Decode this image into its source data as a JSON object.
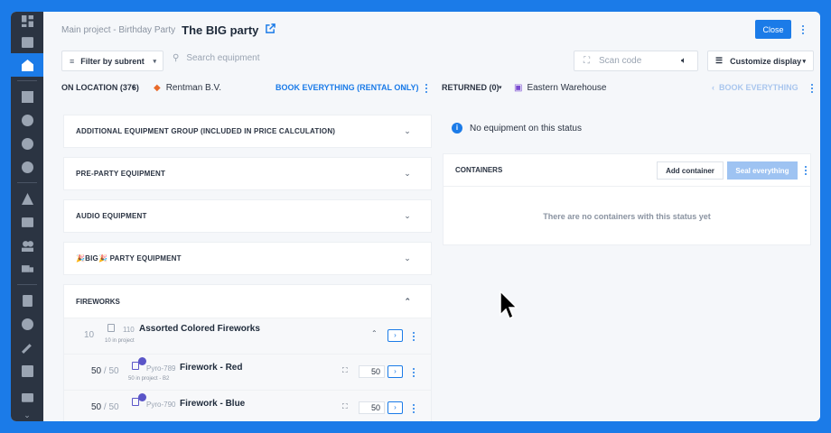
{
  "header": {
    "breadcrumb": "Main project - Birthday Party",
    "title": "The BIG party",
    "close_label": "Close"
  },
  "toolbar": {
    "filter_label": "Filter by subrent",
    "search_placeholder": "Search equipment",
    "scan_placeholder": "Scan code",
    "customize_label": "Customize display"
  },
  "left_status": {
    "label": "ON LOCATION (376)",
    "vendor": "Rentman B.V.",
    "book_label": "BOOK EVERYTHING (RENTAL ONLY)"
  },
  "right_status": {
    "label": "RETURNED (0)",
    "warehouse": "Eastern Warehouse",
    "book_label": "BOOK EVERYTHING"
  },
  "groups": [
    {
      "label": "ADDITIONAL EQUIPMENT GROUP (INCLUDED IN PRICE CALCULATION)"
    },
    {
      "label": "PRE-PARTY EQUIPMENT"
    },
    {
      "label": "AUDIO EQUIPMENT"
    },
    {
      "label": "🎉BIG🎉 PARTY EQUIPMENT"
    }
  ],
  "fireworks": {
    "label": "FIREWORKS",
    "group_item": {
      "qty": "10",
      "code": "110",
      "name": "Assorted Colored Fireworks",
      "sub": "10 in project"
    },
    "items": [
      {
        "qty": "50",
        "total": "50",
        "code": "Pyro-789",
        "name": "Firework - Red",
        "sub": "50 in project - B2",
        "input": "50"
      },
      {
        "qty": "50",
        "total": "50",
        "code": "Pyro-790",
        "name": "Firework - Blue",
        "sub": "",
        "input": "50"
      }
    ]
  },
  "right_panel": {
    "info": "No equipment on this status",
    "containers_label": "CONTAINERS",
    "add_container": "Add container",
    "seal_everything": "Seal everything",
    "empty_text": "There are no containers with this status yet"
  },
  "colors": {
    "accent": "#1b7be8",
    "sidebar": "#2b3442"
  }
}
